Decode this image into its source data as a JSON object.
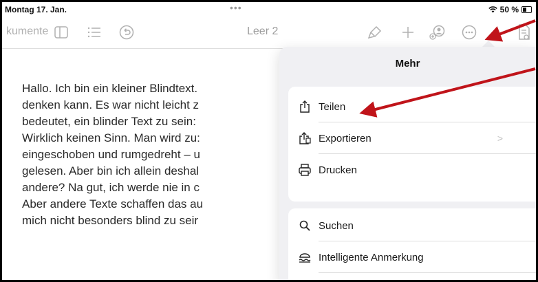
{
  "status": {
    "date": "Montag 17. Jan.",
    "dots": "•••",
    "battery_pct": "50 %"
  },
  "toolbar": {
    "docs_label": "kumente",
    "doc_title": "Leer 2"
  },
  "body_text": "Hallo. Ich bin ein kleiner Blindtext.\ndenken kann. Es war nicht leicht z\nbedeutet, ein blinder Text zu sein:\nWirklich keinen Sinn. Man wird zu:\neingeschoben und rumgedreht – u\ngelesen. Aber bin ich allein deshal\nandere? Na gut, ich werde nie in c\nAber andere Texte schaffen das au\nmich nicht besonders blind zu seir",
  "menu": {
    "title": "Mehr",
    "group1": [
      {
        "label": "Teilen",
        "icon": "share-icon"
      },
      {
        "label": "Exportieren",
        "icon": "export-icon",
        "chevron": ">"
      },
      {
        "label": "Drucken",
        "icon": "printer-icon"
      }
    ],
    "group2": [
      {
        "label": "Suchen",
        "icon": "search-icon"
      },
      {
        "label": "Intelligente Anmerkung",
        "icon": "smart-annotation-icon"
      }
    ]
  },
  "colors": {
    "annotation_arrow": "#c0141a",
    "toolbar_icon": "#b0b0b0"
  }
}
